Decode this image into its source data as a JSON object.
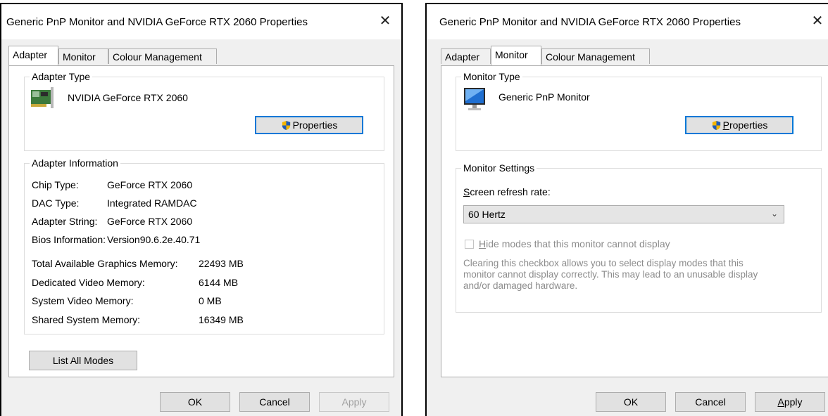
{
  "left": {
    "title": "Generic PnP Monitor and NVIDIA GeForce RTX 2060 Properties",
    "close_glyph": "✕",
    "tabs": [
      "Adapter",
      "Monitor",
      "Colour Management"
    ],
    "adapter_type": {
      "group_label": "Adapter Type",
      "name": "NVIDIA GeForce RTX 2060",
      "properties_label": "Properties"
    },
    "adapter_info": {
      "group_label": "Adapter Information",
      "rows": [
        {
          "label": "Chip Type:",
          "value": "GeForce RTX 2060"
        },
        {
          "label": "DAC Type:",
          "value": "Integrated RAMDAC"
        },
        {
          "label": "Adapter String:",
          "value": "GeForce RTX 2060"
        },
        {
          "label": "Bios Information:",
          "value": "Version90.6.2e.40.71"
        }
      ],
      "memory": [
        {
          "label": "Total Available Graphics Memory:",
          "value": "22493 MB"
        },
        {
          "label": "Dedicated Video Memory:",
          "value": "6144 MB"
        },
        {
          "label": "System Video Memory:",
          "value": "0 MB"
        },
        {
          "label": "Shared System Memory:",
          "value": "16349 MB"
        }
      ]
    },
    "list_all_modes_label": "List All Modes",
    "ok_label": "OK",
    "cancel_label": "Cancel",
    "apply_label": "Apply"
  },
  "right": {
    "title": "Generic PnP Monitor and NVIDIA GeForce RTX 2060 Properties",
    "close_glyph": "✕",
    "tabs": [
      "Adapter",
      "Monitor",
      "Colour Management"
    ],
    "monitor_type": {
      "group_label": "Monitor Type",
      "name": "Generic PnP Monitor",
      "properties_label_underlined": "P",
      "properties_label_rest": "roperties"
    },
    "monitor_settings": {
      "group_label": "Monitor Settings",
      "refresh_label_underlined": "S",
      "refresh_label_rest": "creen refresh rate:",
      "refresh_value": "60 Hertz",
      "hide_modes_underlined": "H",
      "hide_modes_rest": "ide modes that this monitor cannot display",
      "hide_modes_checked": false,
      "warning": "Clearing this checkbox allows you to select display modes that this monitor cannot display correctly. This may lead to an unusable display and/or damaged hardware."
    },
    "ok_label": "OK",
    "cancel_label": "Cancel",
    "apply_underlined": "A",
    "apply_rest": "pply"
  },
  "colors": {
    "accent": "#0078d7",
    "dialog_bg": "#f0f0f0",
    "disabled_text": "#a0a0a0"
  }
}
